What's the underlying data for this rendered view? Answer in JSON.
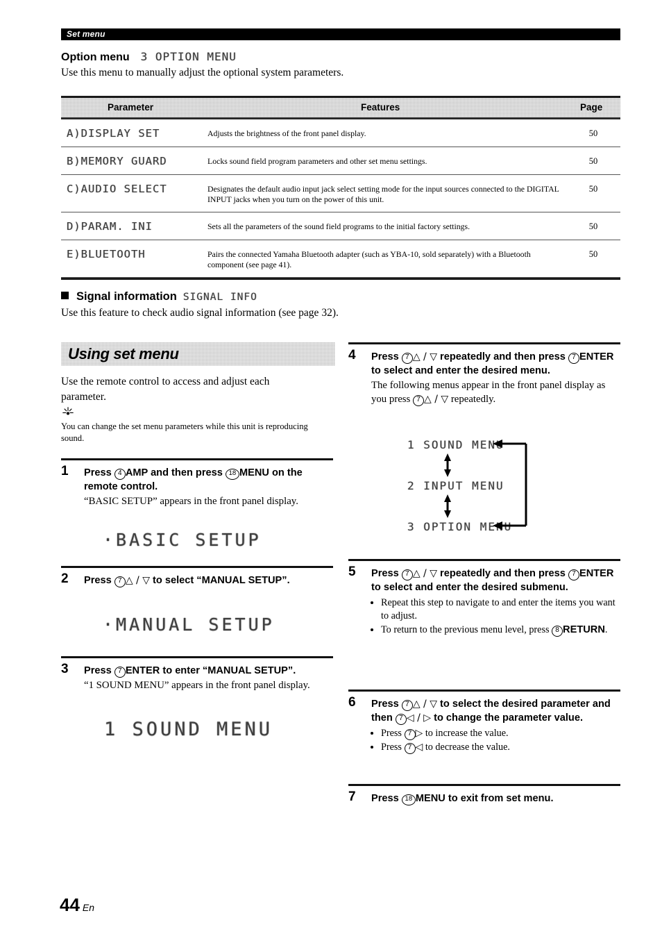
{
  "running_head": "Set menu",
  "option_menu": {
    "title": "Option menu",
    "lcd_label": "3 OPTION MENU",
    "description": "Use this menu to manually adjust the optional system parameters."
  },
  "table": {
    "headers": [
      "Parameter",
      "Features",
      "Page"
    ],
    "rows": [
      {
        "parameter": "A)DISPLAY SET",
        "features": "Adjusts the brightness of the front panel display.",
        "page": "50"
      },
      {
        "parameter": "B)MEMORY GUARD",
        "features": "Locks sound field program parameters and other set menu settings.",
        "page": "50"
      },
      {
        "parameter": "C)AUDIO SELECT",
        "features": "Designates the default audio input jack select setting mode for the input sources connected to the DIGITAL INPUT jacks when you turn on the power of this unit.",
        "page": "50"
      },
      {
        "parameter": "D)PARAM. INI",
        "features": "Sets all the parameters of the sound field programs to the initial factory settings.",
        "page": "50"
      },
      {
        "parameter": "E)BLUETOOTH",
        "features": "Pairs the connected Yamaha Bluetooth adapter (such as YBA-10, sold separately) with a Bluetooth component (see page 41).",
        "page": "50"
      }
    ]
  },
  "signal_information": {
    "title": "Signal information",
    "lcd_label": "SIGNAL INFO",
    "description": "Use this feature to check audio signal information (see page 32)."
  },
  "using_set_menu": {
    "banner": "Using set menu",
    "intro": "Use the remote control to access and adjust each parameter.",
    "tip": "You can change the set menu parameters while this unit is reproducing sound.",
    "steps": [
      {
        "num": "1",
        "lead_a": "Press",
        "badge_a": "4",
        "lead_b": "AMP",
        "lead_c": "and then press",
        "badge_b": "18",
        "lead_d": "MENU",
        "lead_e": "on the remote control.",
        "note": "“BASIC SETUP” appears in the front panel display.",
        "lcd": "·BASIC SETUP"
      },
      {
        "num": "2",
        "lead_a": "Press",
        "badge_a": "7",
        "glyphs": "△ / ▽",
        "lead_b": "to select “MANUAL SETUP”.",
        "lcd": "·MANUAL SETUP"
      },
      {
        "num": "3",
        "lead_a": "Press",
        "badge_a": "7",
        "lead_b": "ENTER",
        "lead_c": "to enter “MANUAL SETUP”.",
        "note": "“1 SOUND MENU” appears in the front panel display.",
        "lcd": "1 SOUND MENU"
      },
      {
        "num": "4",
        "lead_a": "Press",
        "badge_a": "7",
        "glyphs": "△ / ▽",
        "lead_b": "repeatedly and then press",
        "badge_b": "7",
        "lead_c": "ENTER",
        "lead_d": "to select and enter the desired menu.",
        "note_a": "The following menus appear in the front panel display as you press",
        "note_badge": "7",
        "note_glyphs": "△ / ▽",
        "note_b": "repeatedly."
      },
      {
        "num": "5",
        "lead_a": "Press",
        "badge_a": "7",
        "glyphs": "△ / ▽",
        "lead_b": "repeatedly and then press",
        "badge_b": "7",
        "lead_c": "ENTER",
        "lead_d": "to select and enter the desired submenu.",
        "bullets": [
          "Repeat this step to navigate to and enter the items you want to adjust.",
          "To return to the previous menu level, press"
        ],
        "bullet2_badge": "8",
        "bullet2_bold": "RETURN",
        "bullet2_tail": "."
      },
      {
        "num": "6",
        "lead_a": "Press",
        "badge_a": "7",
        "glyphs": "△ / ▽",
        "lead_b": "to select the desired parameter and then",
        "badge_b": "7",
        "glyphs_b": "◁ / ▷",
        "lead_c": "to change the parameter value.",
        "bullet1_pre": "Press",
        "bullet1_badge": "7",
        "bullet1_glyph": "▷",
        "bullet1_post": "to increase the value.",
        "bullet2_pre": "Press",
        "bullet2_badge": "7",
        "bullet2_glyph": "◁",
        "bullet2_post": "to decrease the value."
      },
      {
        "num": "7",
        "lead_a": "Press",
        "badge_a": "18",
        "lead_b": "MENU",
        "lead_c": "to exit from set menu."
      }
    ],
    "menu_cycle": {
      "items": [
        "1 SOUND MENU",
        "2 INPUT MENU",
        "3 OPTION MENU"
      ]
    }
  },
  "footer": {
    "page_number": "44",
    "language": "En"
  }
}
